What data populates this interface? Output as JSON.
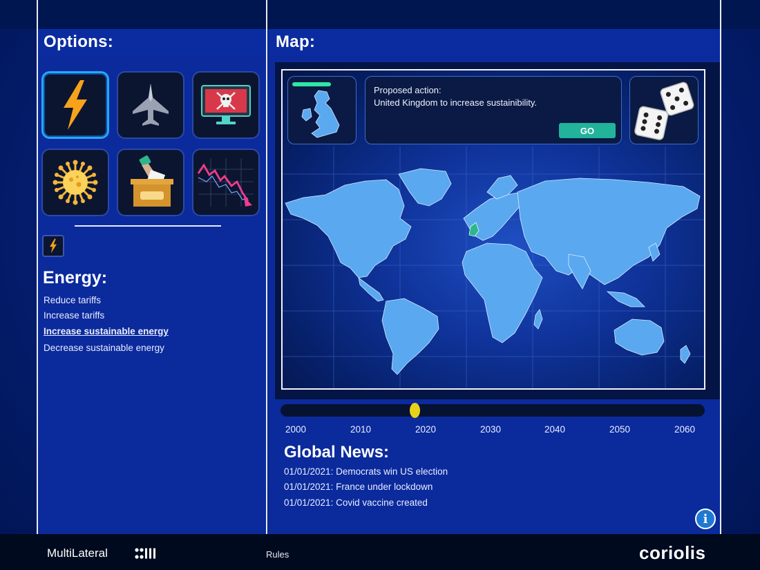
{
  "headers": {
    "options": "Options:",
    "map": "Map:"
  },
  "option_tiles": [
    {
      "name": "energy",
      "icon": "lightning-bolt-icon",
      "active": true
    },
    {
      "name": "military",
      "icon": "fighter-jet-icon",
      "active": false
    },
    {
      "name": "cyber",
      "icon": "skull-monitor-icon",
      "active": false
    },
    {
      "name": "health",
      "icon": "virus-icon",
      "active": false
    },
    {
      "name": "election",
      "icon": "ballot-box-icon",
      "active": false
    },
    {
      "name": "economy",
      "icon": "falling-graph-icon",
      "active": false
    }
  ],
  "category": {
    "title": "Energy:",
    "actions": [
      {
        "label": "Reduce tariffs",
        "selected": false
      },
      {
        "label": "Increase tariffs",
        "selected": false
      },
      {
        "label": "Increase sustainable energy",
        "selected": true
      },
      {
        "label": "Decrease sustainable energy",
        "selected": false
      }
    ]
  },
  "proposal": {
    "label": "Proposed action:",
    "text": "United Kingdom to increase sustainibility.",
    "go_label": "GO"
  },
  "timeline": {
    "years": [
      "2000",
      "2010",
      "2020",
      "2030",
      "2040",
      "2050",
      "2060"
    ],
    "current_year": 2018
  },
  "news": {
    "title": "Global News:",
    "items": [
      "01/01/2021: Democrats win US election",
      "01/01/2021: France under lockdown",
      "01/01/2021: Covid vaccine created"
    ]
  },
  "footer": {
    "brand": "MultiLateral",
    "rules": "Rules",
    "logo": "coriolis"
  },
  "info_label": "i",
  "colors": {
    "accent_green": "#22b39b",
    "timeline_knob": "#e6d21c",
    "active_tile_border": "#2aa7f0",
    "energy_bolt": "#f7a21b",
    "highlight_country": "#2fb58c"
  }
}
